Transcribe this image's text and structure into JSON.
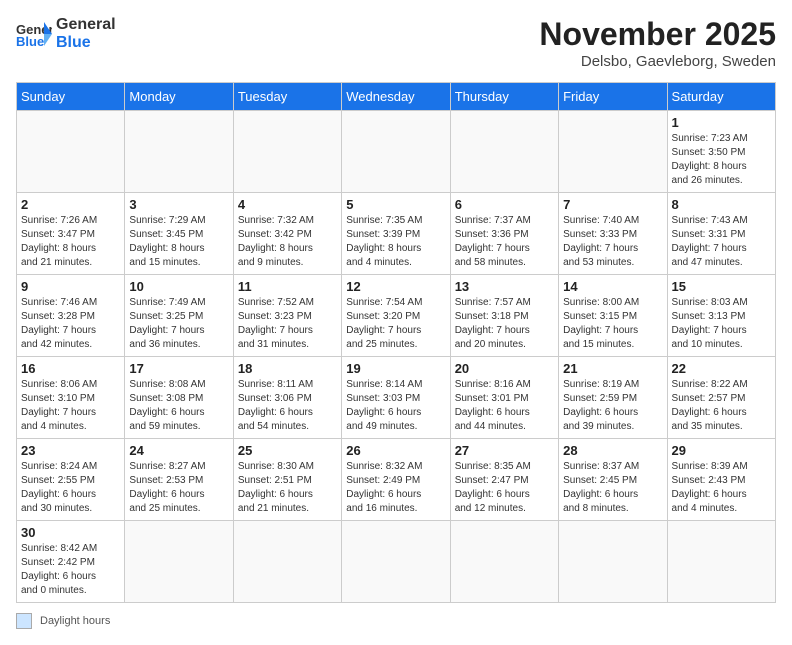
{
  "header": {
    "logo_general": "General",
    "logo_blue": "Blue",
    "month_title": "November 2025",
    "location": "Delsbo, Gaevleborg, Sweden"
  },
  "days_of_week": [
    "Sunday",
    "Monday",
    "Tuesday",
    "Wednesday",
    "Thursday",
    "Friday",
    "Saturday"
  ],
  "weeks": [
    [
      {
        "day": "",
        "info": ""
      },
      {
        "day": "",
        "info": ""
      },
      {
        "day": "",
        "info": ""
      },
      {
        "day": "",
        "info": ""
      },
      {
        "day": "",
        "info": ""
      },
      {
        "day": "",
        "info": ""
      },
      {
        "day": "1",
        "info": "Sunrise: 7:23 AM\nSunset: 3:50 PM\nDaylight: 8 hours\nand 26 minutes."
      }
    ],
    [
      {
        "day": "2",
        "info": "Sunrise: 7:26 AM\nSunset: 3:47 PM\nDaylight: 8 hours\nand 21 minutes."
      },
      {
        "day": "3",
        "info": "Sunrise: 7:29 AM\nSunset: 3:45 PM\nDaylight: 8 hours\nand 15 minutes."
      },
      {
        "day": "4",
        "info": "Sunrise: 7:32 AM\nSunset: 3:42 PM\nDaylight: 8 hours\nand 9 minutes."
      },
      {
        "day": "5",
        "info": "Sunrise: 7:35 AM\nSunset: 3:39 PM\nDaylight: 8 hours\nand 4 minutes."
      },
      {
        "day": "6",
        "info": "Sunrise: 7:37 AM\nSunset: 3:36 PM\nDaylight: 7 hours\nand 58 minutes."
      },
      {
        "day": "7",
        "info": "Sunrise: 7:40 AM\nSunset: 3:33 PM\nDaylight: 7 hours\nand 53 minutes."
      },
      {
        "day": "8",
        "info": "Sunrise: 7:43 AM\nSunset: 3:31 PM\nDaylight: 7 hours\nand 47 minutes."
      }
    ],
    [
      {
        "day": "9",
        "info": "Sunrise: 7:46 AM\nSunset: 3:28 PM\nDaylight: 7 hours\nand 42 minutes."
      },
      {
        "day": "10",
        "info": "Sunrise: 7:49 AM\nSunset: 3:25 PM\nDaylight: 7 hours\nand 36 minutes."
      },
      {
        "day": "11",
        "info": "Sunrise: 7:52 AM\nSunset: 3:23 PM\nDaylight: 7 hours\nand 31 minutes."
      },
      {
        "day": "12",
        "info": "Sunrise: 7:54 AM\nSunset: 3:20 PM\nDaylight: 7 hours\nand 25 minutes."
      },
      {
        "day": "13",
        "info": "Sunrise: 7:57 AM\nSunset: 3:18 PM\nDaylight: 7 hours\nand 20 minutes."
      },
      {
        "day": "14",
        "info": "Sunrise: 8:00 AM\nSunset: 3:15 PM\nDaylight: 7 hours\nand 15 minutes."
      },
      {
        "day": "15",
        "info": "Sunrise: 8:03 AM\nSunset: 3:13 PM\nDaylight: 7 hours\nand 10 minutes."
      }
    ],
    [
      {
        "day": "16",
        "info": "Sunrise: 8:06 AM\nSunset: 3:10 PM\nDaylight: 7 hours\nand 4 minutes."
      },
      {
        "day": "17",
        "info": "Sunrise: 8:08 AM\nSunset: 3:08 PM\nDaylight: 6 hours\nand 59 minutes."
      },
      {
        "day": "18",
        "info": "Sunrise: 8:11 AM\nSunset: 3:06 PM\nDaylight: 6 hours\nand 54 minutes."
      },
      {
        "day": "19",
        "info": "Sunrise: 8:14 AM\nSunset: 3:03 PM\nDaylight: 6 hours\nand 49 minutes."
      },
      {
        "day": "20",
        "info": "Sunrise: 8:16 AM\nSunset: 3:01 PM\nDaylight: 6 hours\nand 44 minutes."
      },
      {
        "day": "21",
        "info": "Sunrise: 8:19 AM\nSunset: 2:59 PM\nDaylight: 6 hours\nand 39 minutes."
      },
      {
        "day": "22",
        "info": "Sunrise: 8:22 AM\nSunset: 2:57 PM\nDaylight: 6 hours\nand 35 minutes."
      }
    ],
    [
      {
        "day": "23",
        "info": "Sunrise: 8:24 AM\nSunset: 2:55 PM\nDaylight: 6 hours\nand 30 minutes."
      },
      {
        "day": "24",
        "info": "Sunrise: 8:27 AM\nSunset: 2:53 PM\nDaylight: 6 hours\nand 25 minutes."
      },
      {
        "day": "25",
        "info": "Sunrise: 8:30 AM\nSunset: 2:51 PM\nDaylight: 6 hours\nand 21 minutes."
      },
      {
        "day": "26",
        "info": "Sunrise: 8:32 AM\nSunset: 2:49 PM\nDaylight: 6 hours\nand 16 minutes."
      },
      {
        "day": "27",
        "info": "Sunrise: 8:35 AM\nSunset: 2:47 PM\nDaylight: 6 hours\nand 12 minutes."
      },
      {
        "day": "28",
        "info": "Sunrise: 8:37 AM\nSunset: 2:45 PM\nDaylight: 6 hours\nand 8 minutes."
      },
      {
        "day": "29",
        "info": "Sunrise: 8:39 AM\nSunset: 2:43 PM\nDaylight: 6 hours\nand 4 minutes."
      }
    ],
    [
      {
        "day": "30",
        "info": "Sunrise: 8:42 AM\nSunset: 2:42 PM\nDaylight: 6 hours\nand 0 minutes."
      },
      {
        "day": "",
        "info": ""
      },
      {
        "day": "",
        "info": ""
      },
      {
        "day": "",
        "info": ""
      },
      {
        "day": "",
        "info": ""
      },
      {
        "day": "",
        "info": ""
      },
      {
        "day": "",
        "info": ""
      }
    ]
  ],
  "footer": {
    "daylight_label": "Daylight hours"
  }
}
